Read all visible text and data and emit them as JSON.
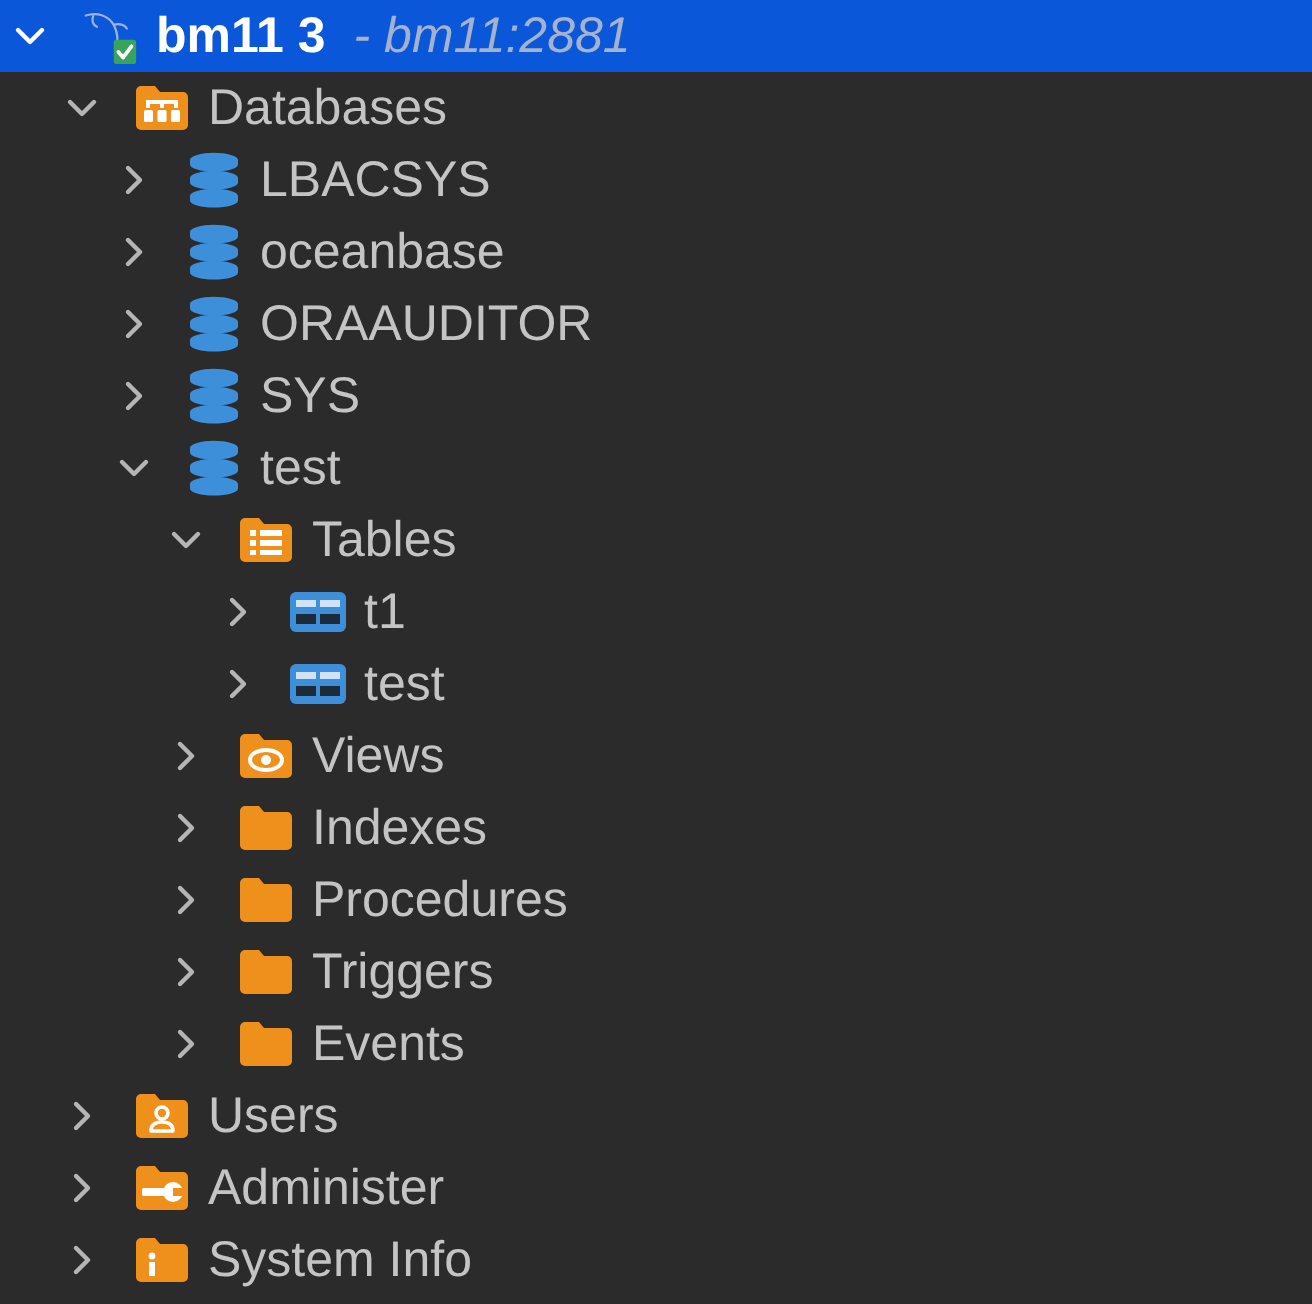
{
  "tree": [
    {
      "kind": "connection",
      "label": "bm11 3",
      "detail": "- bm11:2881",
      "expanded": true,
      "selected": true,
      "children": [
        {
          "kind": "databases",
          "label": "Databases",
          "expanded": true,
          "selected": false,
          "children": [
            {
              "kind": "database",
              "label": "LBACSYS",
              "expanded": false,
              "selected": false
            },
            {
              "kind": "database",
              "label": "oceanbase",
              "expanded": false,
              "selected": false
            },
            {
              "kind": "database",
              "label": "ORAAUDITOR",
              "expanded": false,
              "selected": false
            },
            {
              "kind": "database",
              "label": "SYS",
              "expanded": false,
              "selected": false
            },
            {
              "kind": "database",
              "label": "test",
              "expanded": true,
              "selected": false,
              "children": [
                {
                  "kind": "tables",
                  "label": "Tables",
                  "expanded": true,
                  "selected": false,
                  "children": [
                    {
                      "kind": "table",
                      "label": "t1",
                      "expanded": false,
                      "selected": false
                    },
                    {
                      "kind": "table",
                      "label": "test",
                      "expanded": false,
                      "selected": false
                    }
                  ]
                },
                {
                  "kind": "views",
                  "label": "Views",
                  "expanded": false,
                  "selected": false
                },
                {
                  "kind": "folder",
                  "label": "Indexes",
                  "expanded": false,
                  "selected": false
                },
                {
                  "kind": "folder",
                  "label": "Procedures",
                  "expanded": false,
                  "selected": false
                },
                {
                  "kind": "folder",
                  "label": "Triggers",
                  "expanded": false,
                  "selected": false
                },
                {
                  "kind": "folder",
                  "label": "Events",
                  "expanded": false,
                  "selected": false
                }
              ]
            }
          ]
        },
        {
          "kind": "users",
          "label": "Users",
          "expanded": false,
          "selected": false
        },
        {
          "kind": "admin",
          "label": "Administer",
          "expanded": false,
          "selected": false
        },
        {
          "kind": "info",
          "label": "System Info",
          "expanded": false,
          "selected": false
        }
      ]
    }
  ]
}
